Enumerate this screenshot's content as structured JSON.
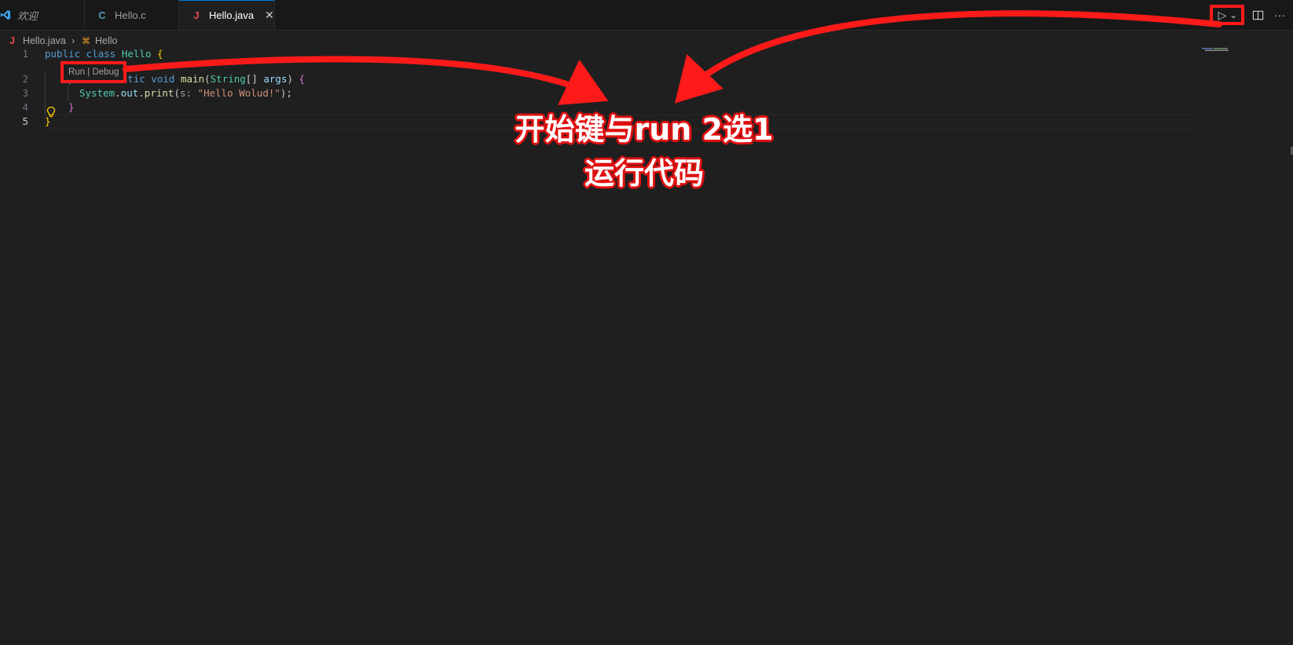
{
  "tabs": [
    {
      "label": "欢迎",
      "icon": "vscode-logo-icon"
    },
    {
      "label": "Hello.c",
      "icon": "c-file-icon",
      "icon_text": "C"
    },
    {
      "label": "Hello.java",
      "icon": "java-file-icon",
      "icon_text": "J",
      "active": true,
      "close": "✕"
    }
  ],
  "actions": {
    "run_icon": "▷",
    "dropdown_icon": "⌄",
    "split_icon": "split-editor-icon",
    "more_icon": "···"
  },
  "breadcrumb": {
    "file_icon_text": "J",
    "file": "Hello.java",
    "separator": "›",
    "symbol_icon": "⌘",
    "symbol": "Hello"
  },
  "codelens": "Run | Debug",
  "line_numbers": [
    "1",
    "2",
    "3",
    "4",
    "5"
  ],
  "code": {
    "l1_kw1": "public",
    "l1_kw2": " class ",
    "l1_name": "Hello ",
    "l1_brace": "{",
    "l2_kw": "public static void ",
    "l2_fn": "main",
    "l2_p1": "(",
    "l2_ty": "String",
    "l2_p2": "[] ",
    "l2_va": "args",
    "l2_p3": ") ",
    "l2_brace": "{",
    "l3_ty": "System",
    "l3_p1": ".",
    "l3_va": "out",
    "l3_p2": ".",
    "l3_fn": "print",
    "l3_p3": "(",
    "l3_hint": "s: ",
    "l3_str": "\"Hello Wolud!\"",
    "l3_p4": ");",
    "l4_brace": "}",
    "l5_brace": "}"
  },
  "annotation": {
    "line1": "开始键与run 2选1",
    "line2": "运行代码"
  },
  "colors": {
    "highlight": "#ff1a1a",
    "accent": "#0078d4"
  }
}
